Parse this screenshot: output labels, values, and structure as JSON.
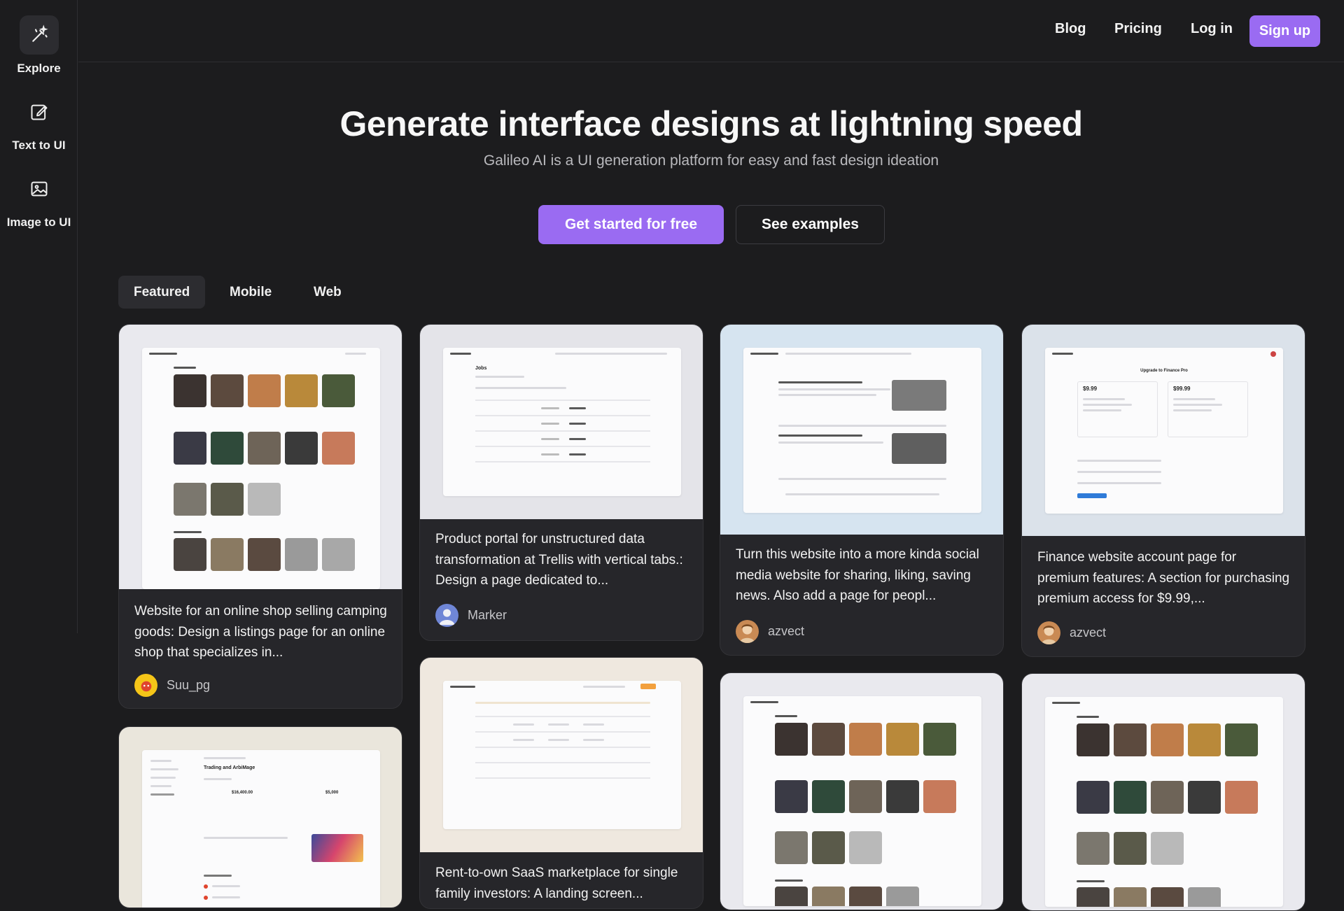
{
  "sidebar": {
    "items": [
      {
        "label": "Explore",
        "icon": "magic-wand-icon"
      },
      {
        "label": "Text to UI",
        "icon": "edit-icon"
      },
      {
        "label": "Image to UI",
        "icon": "image-icon"
      }
    ]
  },
  "nav": {
    "blog": "Blog",
    "pricing": "Pricing",
    "login": "Log in",
    "signup": "Sign up"
  },
  "hero": {
    "title": "Generate interface designs at lightning speed",
    "subtitle": "Galileo AI is a UI generation platform for easy and fast design ideation",
    "cta_primary": "Get started for free",
    "cta_secondary": "See examples"
  },
  "tabs": [
    "Featured",
    "Mobile",
    "Web"
  ],
  "cards": [
    {
      "text": "Website for an online shop selling camping goods: Design a listings page for an online shop that specializes in...",
      "author": "Suu_pg",
      "avatar_color": "#f5c518"
    },
    {
      "text": "Product portal for unstructured data transformation at Trellis with vertical tabs.: Design a page dedicated to...",
      "author": "Marker",
      "avatar_color": "#6f86d6"
    },
    {
      "text": "Turn this website into a more kinda social media website for sharing, liking, saving news. Also add a page for peopl...",
      "author": "azvect",
      "avatar_color": "#c98a54"
    },
    {
      "text": "Finance website account page for premium features: A section for purchasing premium access for $9.99,...",
      "author": "azvect",
      "avatar_color": "#c98a54"
    },
    {
      "text": "Rent-to-own SaaS marketplace for single family investors: A landing screen..."
    }
  ],
  "previews": {
    "trellis_heading": "Jobs",
    "trading_heading": "Trading and ArbiMage",
    "finance_price_1": "$9.99",
    "finance_price_2": "$99.99",
    "finance_heading": "Upgrade to Finance Pro",
    "trading_value_1": "$16,400.00",
    "trading_value_2": "$5,000"
  },
  "colors": {
    "accent": "#9a6bf2",
    "background": "#1c1c1e",
    "card": "#26262a"
  }
}
